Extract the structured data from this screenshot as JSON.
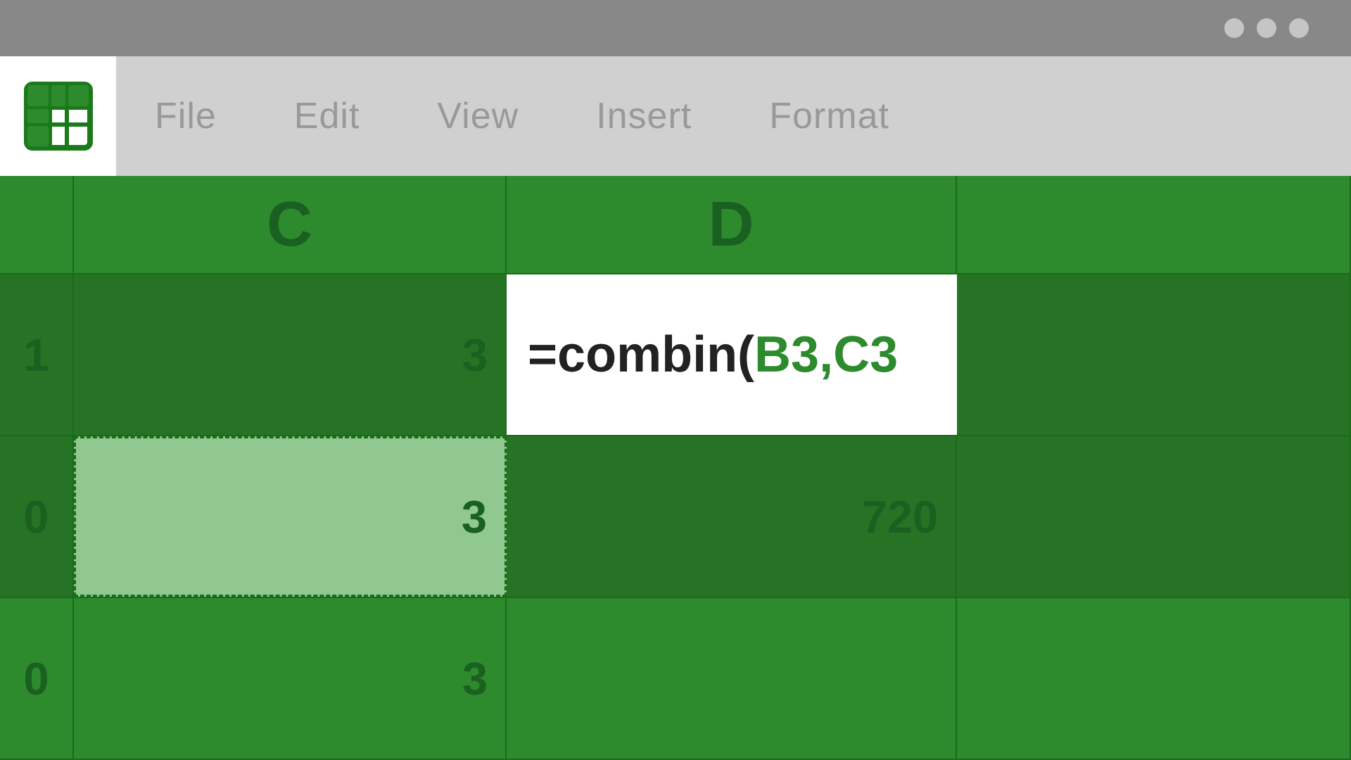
{
  "titleBar": {
    "windowButtons": [
      "minimize",
      "maximize",
      "close"
    ]
  },
  "menuBar": {
    "logoAlt": "Spreadsheet App",
    "menuItems": [
      {
        "id": "file",
        "label": "File"
      },
      {
        "id": "edit",
        "label": "Edit"
      },
      {
        "id": "view",
        "label": "View"
      },
      {
        "id": "insert",
        "label": "Insert"
      },
      {
        "id": "format",
        "label": "Format"
      }
    ]
  },
  "spreadsheet": {
    "columns": [
      "C",
      "D"
    ],
    "rows": [
      {
        "rowNum": "1",
        "cells": [
          {
            "col": "C",
            "value": "3"
          },
          {
            "col": "D",
            "value": "=combin(B3,C3",
            "isFormula": true,
            "formulaBlack": "=combin(",
            "formulaGreen": "B3,C3"
          }
        ]
      },
      {
        "rowNum": "0",
        "cells": [
          {
            "col": "C",
            "value": "3",
            "isSelected": true
          },
          {
            "col": "D",
            "value": "720"
          }
        ]
      },
      {
        "rowNum": "0",
        "cells": [
          {
            "col": "C",
            "value": "3"
          },
          {
            "col": "D",
            "value": ""
          }
        ]
      }
    ]
  },
  "colors": {
    "gridGreen": "#2d8a2d",
    "darkGreen": "#267326",
    "borderGreen": "#1a6b1a",
    "textGreen": "#1a6020",
    "selectedCell": "#90c890",
    "formulaGreen": "#2d8a2d",
    "white": "#ffffff",
    "menuGray": "#d0d0d0",
    "titleGray": "#888888",
    "menuTextGray": "#999999",
    "windowBtnGray": "#cccccc"
  }
}
